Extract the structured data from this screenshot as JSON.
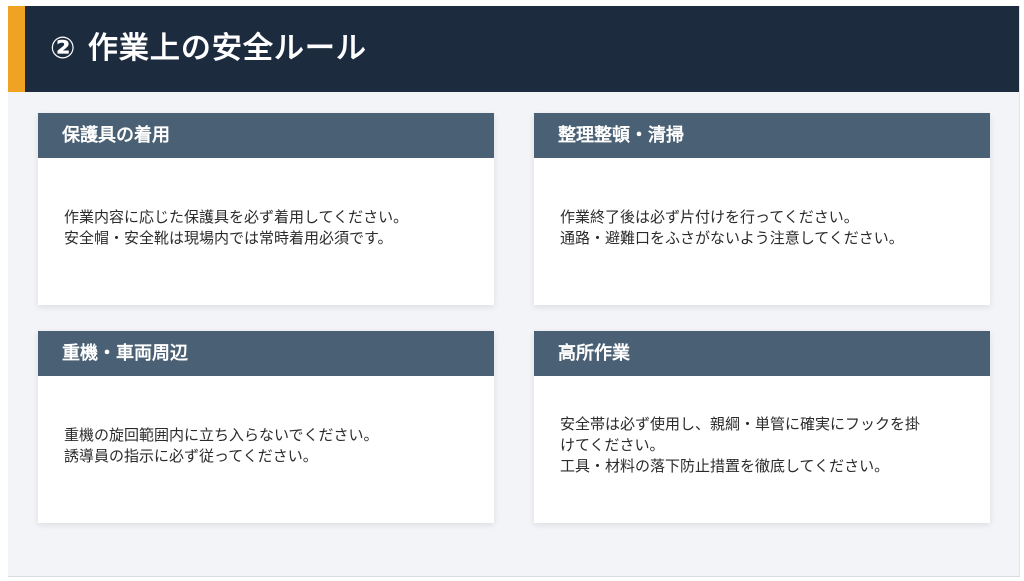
{
  "header": {
    "title": "② 作業上の安全ルール",
    "accent_color": "#f0a323",
    "background_color": "#1c2b3d"
  },
  "cards": [
    {
      "title": "保護具の着用",
      "lines": [
        "作業内容に応じた保護具を必ず着用してください。",
        "安全帽・安全靴は現場内では常時着用必須です。"
      ]
    },
    {
      "title": "整理整頓・清掃",
      "lines": [
        "作業終了後は必ず片付けを行ってください。",
        "通路・避難口をふさがないよう注意してください。"
      ]
    },
    {
      "title": "重機・車両周辺",
      "lines": [
        "重機の旋回範囲内に立ち入らないでください。",
        "誘導員の指示に必ず従ってください。"
      ]
    },
    {
      "title": "高所作業",
      "lines": [
        "安全帯は必ず使用し、親綱・単管に確実にフックを掛",
        "けてください。",
        "工具・材料の落下防止措置を徹底してください。"
      ]
    }
  ],
  "colors": {
    "card_header": "#4a6074",
    "page_background": "#f3f4f7"
  }
}
